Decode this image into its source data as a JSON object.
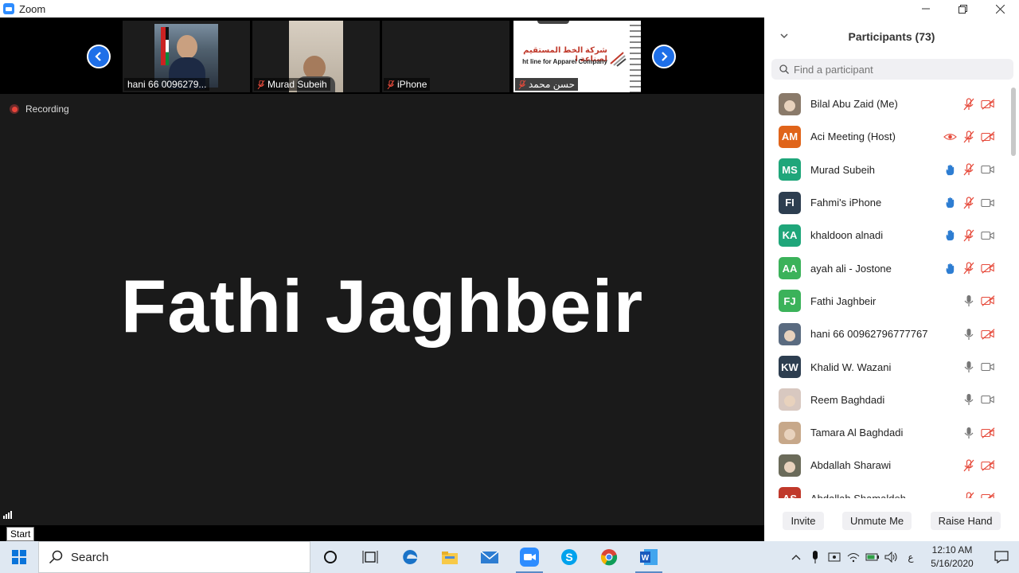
{
  "window": {
    "app_title": "Zoom",
    "minimize_icon": "minimize-icon",
    "maximize_icon": "restore-icon",
    "close_icon": "close-icon"
  },
  "video": {
    "tiles": [
      {
        "label": "hani 66 0096279...",
        "muted": false
      },
      {
        "label": "Murad Subeih",
        "muted": true
      },
      {
        "label": "iPhone",
        "muted": true
      },
      {
        "label": "حسن محمد",
        "muted": true,
        "banner_text_ar": "شركة الخط المستقيم لصناعة ا",
        "banner_text_en": "ht line for Apparel Company"
      }
    ],
    "recording_label": "Recording",
    "active_speaker": "Fathi Jaghbeir",
    "start_tooltip": "Start"
  },
  "panel": {
    "title": "Participants (73)",
    "search_placeholder": "Find a participant",
    "participants": [
      {
        "name": "Bilal Abu Zaid (Me)",
        "initials": "",
        "color": "#8a7a6a",
        "hand": false,
        "rec": false,
        "mic": "muted",
        "video": "off"
      },
      {
        "name": "Aci Meeting (Host)",
        "initials": "AM",
        "color": "#e0641a",
        "hand": false,
        "rec": true,
        "mic": "muted",
        "video": "off"
      },
      {
        "name": "Murad Subeih",
        "initials": "MS",
        "color": "#1fa67a",
        "hand": true,
        "rec": false,
        "mic": "muted",
        "video": "on"
      },
      {
        "name": "Fahmi's iPhone",
        "initials": "FI",
        "color": "#2d3e50",
        "hand": true,
        "rec": false,
        "mic": "muted",
        "video": "on"
      },
      {
        "name": "khaldoon alnadi",
        "initials": "KA",
        "color": "#1fa67a",
        "hand": true,
        "rec": false,
        "mic": "muted",
        "video": "on"
      },
      {
        "name": "ayah ali - Jostone",
        "initials": "AA",
        "color": "#3bb25a",
        "hand": true,
        "rec": false,
        "mic": "muted",
        "video": "off"
      },
      {
        "name": "Fathi Jaghbeir",
        "initials": "FJ",
        "color": "#3bb25a",
        "hand": false,
        "rec": false,
        "mic": "on",
        "video": "off"
      },
      {
        "name": "hani 66 00962796777767",
        "initials": "",
        "color": "#5a6b80",
        "hand": false,
        "rec": false,
        "mic": "on",
        "video": "off"
      },
      {
        "name": "Khalid W. Wazani",
        "initials": "KW",
        "color": "#2d3e50",
        "hand": false,
        "rec": false,
        "mic": "on",
        "video": "on"
      },
      {
        "name": "Reem Baghdadi",
        "initials": "",
        "color": "#d8c8c0",
        "hand": false,
        "rec": false,
        "mic": "on",
        "video": "on"
      },
      {
        "name": "Tamara Al Baghdadi",
        "initials": "",
        "color": "#c7a88a",
        "hand": false,
        "rec": false,
        "mic": "on",
        "video": "off"
      },
      {
        "name": "Abdallah Sharawi",
        "initials": "",
        "color": "#6b6b5a",
        "hand": false,
        "rec": false,
        "mic": "muted",
        "video": "off"
      },
      {
        "name": "Abdallah Shamaldeh",
        "initials": "AS",
        "color": "#c0392b",
        "hand": false,
        "rec": false,
        "mic": "muted",
        "video": "off"
      }
    ],
    "buttons": {
      "invite": "Invite",
      "unmute": "Unmute Me",
      "raise_hand": "Raise Hand"
    }
  },
  "taskbar": {
    "search_label": "Search",
    "lang": "ع",
    "time": "12:10 AM",
    "date": "5/16/2020",
    "apps": [
      "cortana-icon",
      "task-view-icon",
      "edge-icon",
      "file-explorer-icon",
      "mail-icon",
      "zoom-icon",
      "skype-icon",
      "chrome-icon",
      "word-icon"
    ]
  }
}
